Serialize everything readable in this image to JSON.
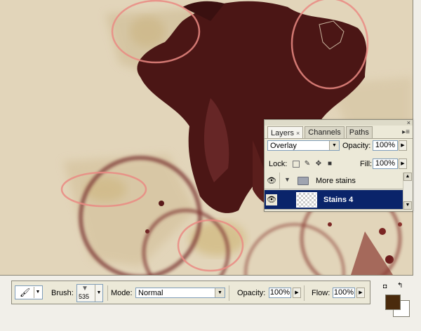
{
  "layers_panel": {
    "tabs": [
      {
        "label": "Layers",
        "active": true
      },
      {
        "label": "Channels",
        "active": false
      },
      {
        "label": "Paths",
        "active": false
      }
    ],
    "blend_mode": "Overlay",
    "opacity_label": "Opacity:",
    "opacity_value": "100%",
    "lock_label": "Lock:",
    "fill_label": "Fill:",
    "fill_value": "100%",
    "layers": [
      {
        "name": "More stains",
        "type": "group",
        "visible": true,
        "selected": false
      },
      {
        "name": "Stains 4",
        "type": "layer",
        "visible": true,
        "selected": true
      }
    ]
  },
  "options_bar": {
    "brush_label": "Brush:",
    "brush_size": "535",
    "mode_label": "Mode:",
    "mode_value": "Normal",
    "opacity_label": "Opacity:",
    "opacity_value": "100%",
    "flow_label": "Flow:",
    "flow_value": "100%"
  },
  "colors": {
    "foreground": "#4a2a0c",
    "background": "#ffffff",
    "selection": "#0a246a",
    "paper": "#e0d4bb",
    "stain": "#4e1a18"
  }
}
